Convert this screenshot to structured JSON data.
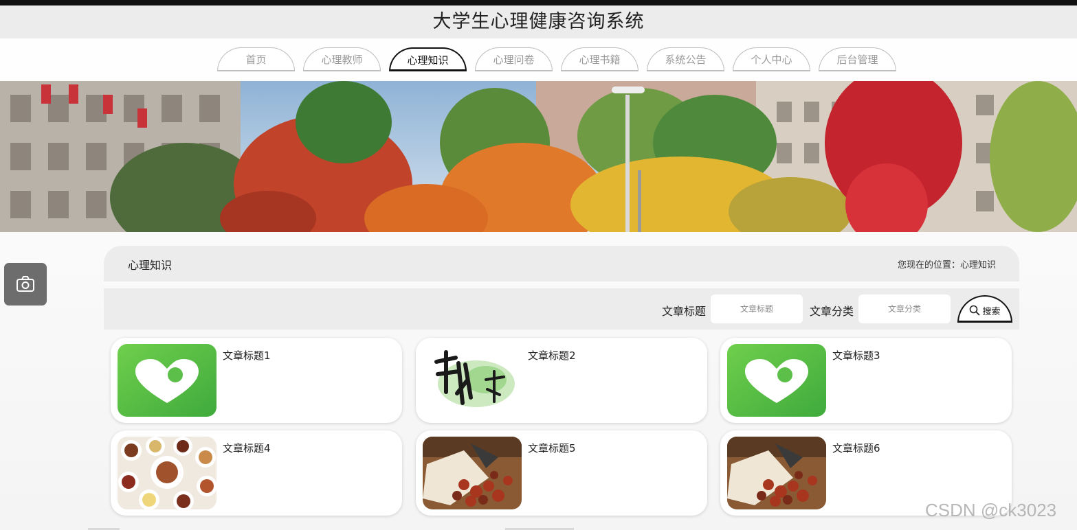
{
  "site": {
    "title": "大学生心理健康咨询系统"
  },
  "nav": {
    "active_index": 2,
    "items": [
      {
        "label": "首页"
      },
      {
        "label": "心理教师"
      },
      {
        "label": "心理知识"
      },
      {
        "label": "心理问卷"
      },
      {
        "label": "心理书籍"
      },
      {
        "label": "系统公告"
      },
      {
        "label": "个人中心"
      },
      {
        "label": "后台管理"
      }
    ]
  },
  "breadcrumb": {
    "title": "心理知识",
    "location": "您现在的位置：心理知识"
  },
  "search": {
    "title_label": "文章标题",
    "title_placeholder": "文章标题",
    "category_label": "文章分类",
    "category_placeholder": "文章分类",
    "button_label": "搜索",
    "button_icon": "search-icon"
  },
  "articles": [
    {
      "title": "文章标题1",
      "thumbnail": "heart-logo-icon"
    },
    {
      "title": "文章标题2",
      "thumbnail": "jiankang-calligraphy"
    },
    {
      "title": "文章标题3",
      "thumbnail": "heart-logo-icon"
    },
    {
      "title": "文章标题4",
      "thumbnail": "grains-bowls-photo"
    },
    {
      "title": "文章标题5",
      "thumbnail": "dried-fruit-bag-photo"
    },
    {
      "title": "文章标题6",
      "thumbnail": "dried-fruit-bag-photo"
    }
  ],
  "banner": {
    "subject": "campus-autumn-trees-photo"
  },
  "floating": {
    "icon": "camera-icon"
  },
  "watermark": {
    "text": "CSDN @ck3023"
  },
  "colors": {
    "heart_green": "#5cbf4a",
    "active_tab_border": "#111111",
    "panel_bg": "#ececec"
  }
}
